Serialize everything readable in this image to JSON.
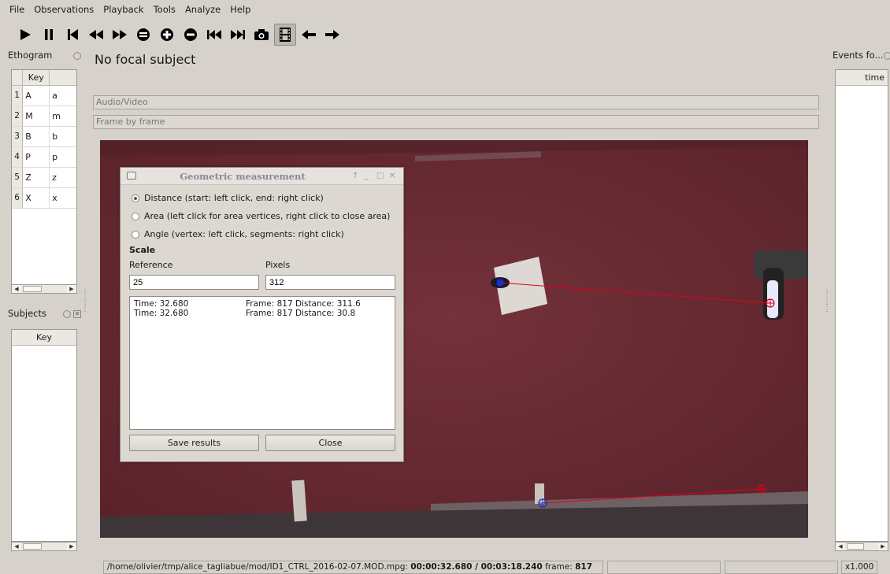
{
  "menu": [
    "File",
    "Observations",
    "Playback",
    "Tools",
    "Analyze",
    "Help"
  ],
  "toolbar": [
    {
      "name": "play-icon"
    },
    {
      "name": "pause-icon"
    },
    {
      "name": "skip-to-start-icon"
    },
    {
      "name": "rewind-icon"
    },
    {
      "name": "fast-forward-icon"
    },
    {
      "name": "reset-speed-icon"
    },
    {
      "name": "speed-up-icon"
    },
    {
      "name": "speed-down-icon"
    },
    {
      "name": "previous-media-icon"
    },
    {
      "name": "next-media-icon"
    },
    {
      "name": "snapshot-icon"
    },
    {
      "name": "frame-by-frame-icon"
    },
    {
      "name": "previous-frame-icon"
    },
    {
      "name": "next-frame-icon"
    }
  ],
  "ethogram": {
    "title": "Ethogram",
    "header": "Key",
    "rows": [
      {
        "num": "1",
        "code": "A",
        "key": "a"
      },
      {
        "num": "2",
        "code": "M",
        "key": "m"
      },
      {
        "num": "3",
        "code": "B",
        "key": "b"
      },
      {
        "num": "4",
        "code": "P",
        "key": "p"
      },
      {
        "num": "5",
        "code": "Z",
        "key": "z"
      },
      {
        "num": "6",
        "code": "X",
        "key": "x"
      }
    ]
  },
  "subjects": {
    "title": "Subjects",
    "header": "Key"
  },
  "events": {
    "title": "Events fo...",
    "header": "time"
  },
  "main": {
    "focal_title": "No focal subject",
    "audio_video_label": "Audio/Video",
    "frame_by_frame_label": "Frame by frame"
  },
  "dialog": {
    "title": "Geometric measurement",
    "controls": [
      "↑",
      "_",
      "□",
      "✕"
    ],
    "options": [
      {
        "label": "Distance (start: left click, end: right click)",
        "selected": true
      },
      {
        "label": "Area (left click for area vertices, right click to close area)",
        "selected": false
      },
      {
        "label": "Angle (vertex: left click, segments: right click)",
        "selected": false
      }
    ],
    "scale_label": "Scale",
    "reference_label": "Reference",
    "pixels_label": "Pixels",
    "reference_value": "25",
    "pixels_value": "312",
    "results": [
      {
        "time": "Time: 32.680",
        "rest": "Frame: 817  Distance: 311.6"
      },
      {
        "time": "Time: 32.680",
        "rest": "Frame: 817  Distance: 30.8"
      }
    ],
    "save_label": "Save results",
    "close_label": "Close"
  },
  "status": {
    "path": "/home/olivier/tmp/alice_tagliabue/mod/ID1_CTRL_2016-02-07.MOD.mpg: ",
    "time": "00:00:32.680 / 00:03:18.240",
    "frame_label": " frame: ",
    "frame": "817",
    "speed": "x1.000"
  },
  "colors": {
    "window_bg": "#d6d2cb",
    "video_floor": "#6a2d34",
    "measure_line": "#e0001a",
    "start_marker": "#1a2fd0"
  }
}
